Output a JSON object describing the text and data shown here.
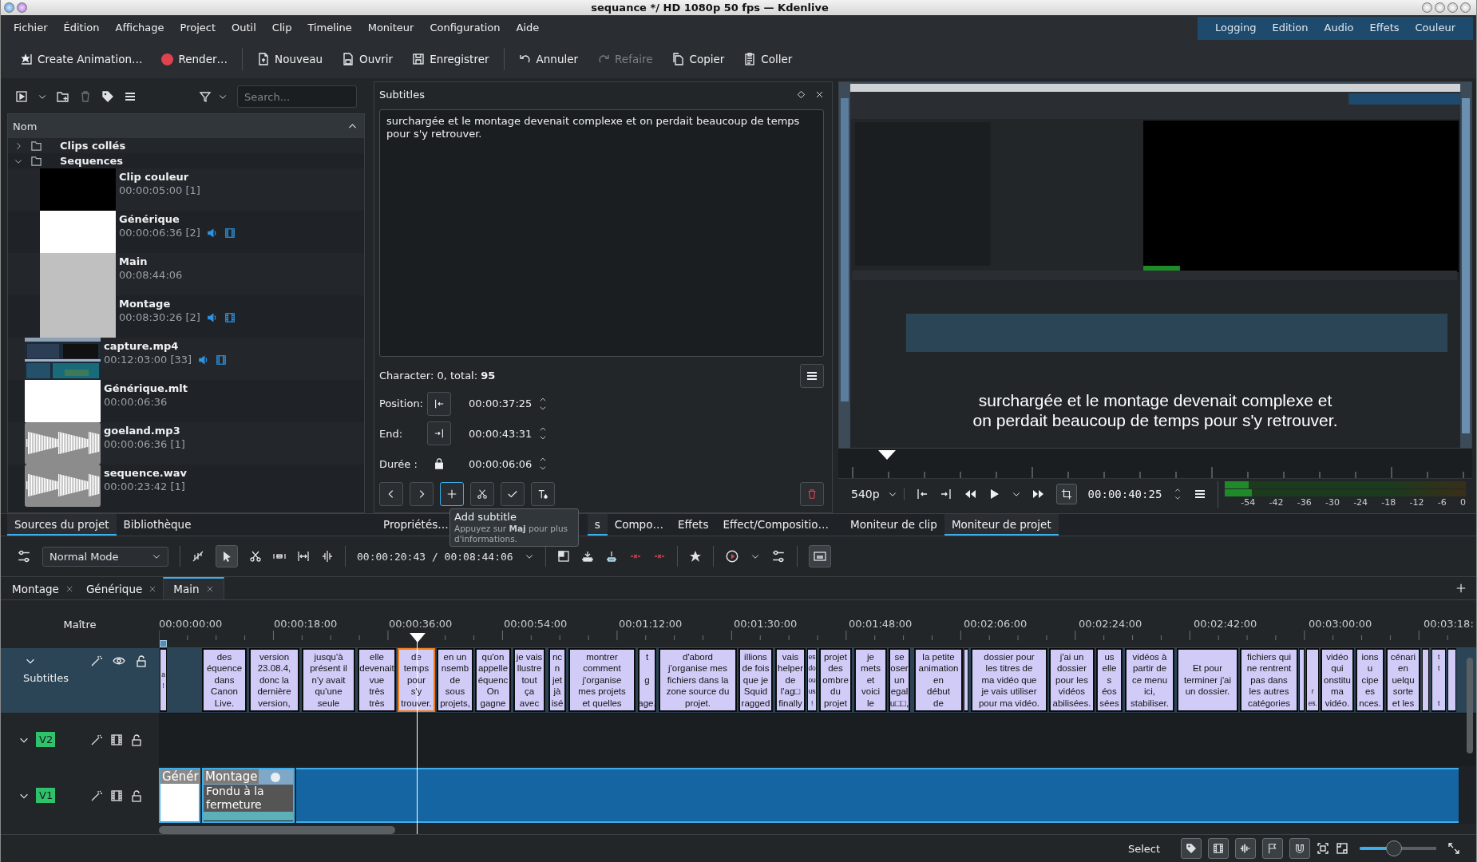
{
  "window": {
    "title": "sequance */ HD 1080p 50 fps — Kdenlive"
  },
  "menu": [
    "Fichier",
    "Édition",
    "Affichage",
    "Project",
    "Outil",
    "Clip",
    "Timeline",
    "Moniteur",
    "Configuration",
    "Aide"
  ],
  "workspaces": [
    {
      "label": "Logging",
      "selected": false
    },
    {
      "label": "Edition",
      "selected": false
    },
    {
      "label": "Audio",
      "selected": false
    },
    {
      "label": "Effets",
      "selected": false
    },
    {
      "label": "Couleur",
      "selected": false
    }
  ],
  "toolbar": [
    {
      "label": "Create Animation…",
      "kind": "animation",
      "disabled": false,
      "separator": false
    },
    {
      "label": "Render…",
      "kind": "render",
      "disabled": false,
      "separator": false
    },
    {
      "label": "Nouveau",
      "kind": "new",
      "disabled": false,
      "separator": true
    },
    {
      "label": "Ouvrir",
      "kind": "open",
      "disabled": false,
      "separator": false
    },
    {
      "label": "Enregistrer",
      "kind": "save",
      "disabled": false,
      "separator": false
    },
    {
      "label": "Annuler",
      "kind": "undo",
      "disabled": false,
      "separator": true
    },
    {
      "label": "Refaire",
      "kind": "redo",
      "disabled": true,
      "separator": false
    },
    {
      "label": "Copier",
      "kind": "copy",
      "disabled": false,
      "separator": false
    },
    {
      "label": "Coller",
      "kind": "paste",
      "disabled": false,
      "separator": false
    }
  ],
  "bin": {
    "search_placeholder": "Search...",
    "column": "Nom",
    "items": [
      {
        "kind": "folder",
        "name": "Clips collés",
        "expanded": false
      },
      {
        "kind": "folder",
        "name": "Sequences",
        "expanded": true,
        "children": [
          {
            "kind": "color",
            "color": "#000000",
            "name": "Clip couleur",
            "duration": "00:00:05:00 [1]",
            "audio": false,
            "video": false
          },
          {
            "kind": "color",
            "color": "#ffffff",
            "name": "Générique",
            "duration": "00:00:06:36 [2]",
            "audio": true,
            "video": true
          },
          {
            "kind": "color",
            "color": "#c0c0c0",
            "name": "Main",
            "duration": "00:08:44:06",
            "audio": false,
            "video": false
          },
          {
            "kind": "color",
            "color": "#c0c0c0",
            "name": "Montage",
            "duration": "00:08:30:26 [2]",
            "audio": true,
            "video": true
          }
        ]
      },
      {
        "kind": "video",
        "name": "capture.mp4",
        "duration": "00:12:03:00 [33]",
        "audio": true,
        "video": true
      },
      {
        "kind": "color",
        "color": "#ffffff",
        "name": "Générique.mlt",
        "duration": "00:00:06:36",
        "audio": false,
        "video": false
      },
      {
        "kind": "audio",
        "name": "goeland.mp3",
        "duration": "00:00:06:36 [1]",
        "audio": false,
        "video": false
      },
      {
        "kind": "audio",
        "name": "sequence.wav",
        "duration": "00:00:23:42 [1]",
        "audio": false,
        "video": false
      }
    ]
  },
  "subtitle_editor": {
    "title": "Subtitles",
    "text": "surchargée et le montage devenait complexe et on perdait beaucoup de temps pour s'y retrouver.",
    "counter": "Character: 0, total: **95**",
    "fields": [
      {
        "kind": "start",
        "label": "Position:",
        "value": "00:00:37:25"
      },
      {
        "kind": "end",
        "label": "End:",
        "value": "00:00:43:31"
      },
      {
        "kind": "lock",
        "label": "Durée :",
        "value": "00:00:06:06"
      }
    ],
    "tooltip": {
      "title": "Add subtitle",
      "hint": "Appuyez sur **Maj** pour plus d'informations."
    }
  },
  "monitor": {
    "overlay": [
      "surchargée et le montage devenait complexe et",
      "on perdait beaucoup de temps pour s'y retrouver."
    ],
    "resolution": "540p",
    "timecode": "00:00:40:25",
    "meter": {
      "channels": [
        {
          "level": 0.1
        },
        {
          "level": 0.11
        }
      ],
      "scale": [
        "-54",
        "-42",
        "-36",
        "-30",
        "-24",
        "-18",
        "-12",
        "-6",
        "0"
      ]
    }
  },
  "dock_tabs": [
    [
      {
        "label": "Sources du projet",
        "selected": true
      },
      {
        "label": "Bibliothèque",
        "selected": false
      }
    ],
    [
      {
        "label": "Propriétés…",
        "selected": false
      },
      {
        "label": "s",
        "selected": true
      },
      {
        "label": "Compo…",
        "selected": false
      },
      {
        "label": "Effets",
        "selected": false
      },
      {
        "label": "Effect/Compositio…",
        "selected": false
      }
    ],
    [
      {
        "label": "Moniteur de clip",
        "selected": false
      },
      {
        "label": "Moniteur de projet",
        "selected": true
      }
    ]
  ],
  "timeline": {
    "mode": "Normal Mode",
    "position": "00:00:20:43 / 00:08:44:06",
    "tabs": [
      {
        "label": "Montage",
        "selected": false
      },
      {
        "label": "Générique",
        "selected": false
      },
      {
        "label": "Main",
        "selected": true
      }
    ],
    "master": "Maître",
    "ruler": [
      "00:00:00:00",
      "00:00:18:00",
      "00:00:36:00",
      "00:00:54:00",
      "00:01:12:00",
      "00:01:30:00",
      "00:01:48:00",
      "00:02:06:00",
      "00:02:24:00",
      "00:02:42:00",
      "00:03:00:00",
      "00:03:18:"
    ],
    "subtitle_track": {
      "name": "Subtitles",
      "clips": [
        {
          "text": "a\n!",
          "selected": false
        },
        {
          "text": "des\néquence\ndans\nCanon\nLive.",
          "selected": false
        },
        {
          "text": "version\n23.08.4,\ndonc la\ndernière\nversion,",
          "selected": false
        },
        {
          "text": "jusqu'à\nprésent il\nn'y avait\nqu'une\nseule",
          "selected": false
        },
        {
          "text": "elle\ndevenait\nvue\ntrès\ntrès",
          "selected": false
        },
        {
          "text": "de\ntemps\npour\ns'y\ntrouver.",
          "selected": true
        },
        {
          "text": "en un\nnsemb\nde\nsous\nprojets,",
          "selected": false
        },
        {
          "text": "qu'on\nappelle\néquenc\nOn\ngagne",
          "selected": false
        },
        {
          "text": "je vais\nllustre\ntout\nça\navec",
          "selected": false
        },
        {
          "text": "nc\nn\njet\njà\nisé",
          "selected": false
        },
        {
          "text": "montrer\ncomment\nj'organise\nmes projets\net quelles",
          "selected": false
        },
        {
          "text": "t\n\ng\n\nage.",
          "selected": false
        },
        {
          "text": "d'abord\nj'organise mes\nfichiers dans la\nzone source du\nprojet.",
          "selected": false
        },
        {
          "text": "illions\nde fois\nque je\nSquid\nragged",
          "selected": false
        },
        {
          "text": "vais\nhelper\nde\nl'ag□\nfinally",
          "selected": false
        },
        {
          "text": "es\ndo\nou\nus\n!",
          "selected": false
        },
        {
          "text": "projet\ndes\nombre\ndu\nprojet",
          "selected": false
        },
        {
          "text": "je\nmets\net\nvoici\nle",
          "selected": false
        },
        {
          "text": "se\noser\nun\negal\nu□□,",
          "selected": false
        },
        {
          "text": "la petite\nanimation\nen\ndébut\nde",
          "selected": false
        },
        {
          "selected": false
        },
        {
          "text": "dossier pour\nles titres de\nma vidéo que\nje vais utiliser\npour ma vidéo.",
          "selected": false
        },
        {
          "text": "j'ai un\ndossier\npour les\nvidéos\nabilisées.",
          "selected": false
        },
        {
          "text": "us\nelle\ns\néos\nsées",
          "selected": false
        },
        {
          "text": "vidéos à\npartir de\nce menu\nici,\nstabiliser.",
          "selected": false
        },
        {
          "text": "Et pour\nterminer j'ai\nun dossier.",
          "selected": false
        },
        {
          "text": "fichiers qui\nne rentrent\npas dans\nles autres\ncatégories",
          "selected": false
        },
        {
          "selected": false
        },
        {
          "text": "\n\n\nr\nes.",
          "selected": false
        },
        {
          "text": "vidéo\nqui\nonstitu\nma\nvidéo.",
          "selected": false
        },
        {
          "text": "ions\nu\ncipe\nes\nnces.",
          "selected": false
        },
        {
          "text": "cénari\nen\nuelqu\nsorte\net les",
          "selected": false
        },
        {
          "selected": false
        },
        {
          "text": "t\nt\n\n\nt",
          "selected": false
        },
        {
          "selected": false
        }
      ]
    },
    "tracks": [
      {
        "name": "V2"
      },
      {
        "name": "V1",
        "clips": [
          {
            "kind": "color",
            "label": "Génér"
          },
          {
            "kind": "video",
            "label": "Montage",
            "effect": "Fondu à la fermeture"
          }
        ]
      }
    ]
  },
  "status": {
    "tool": "Select",
    "toggles": [
      {
        "kind": "tag",
        "on": true
      },
      {
        "kind": "film",
        "on": true
      },
      {
        "kind": "wave",
        "on": true
      },
      {
        "kind": "flag",
        "on": true
      },
      {
        "kind": "magnet",
        "on": true
      }
    ],
    "zoom": {
      "level": 0.45
    }
  }
}
